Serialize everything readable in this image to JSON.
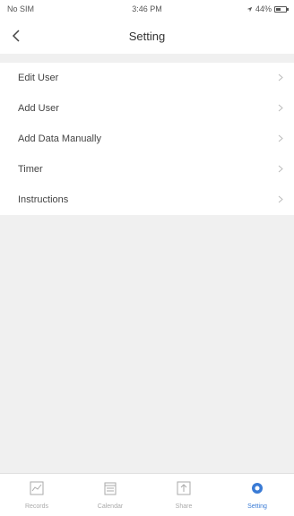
{
  "status_bar": {
    "carrier": "No SIM",
    "time": "3:46 PM",
    "battery": "44%"
  },
  "nav": {
    "title": "Setting",
    "back_icon": "chevron-left-icon"
  },
  "menu": {
    "items": [
      {
        "label": "Edit User"
      },
      {
        "label": "Add User"
      },
      {
        "label": "Add Data Manually"
      },
      {
        "label": "Timer"
      },
      {
        "label": "Instructions"
      }
    ]
  },
  "tab_bar": {
    "tabs": [
      {
        "label": "Records",
        "icon": "records-icon",
        "active": false
      },
      {
        "label": "Calendar",
        "icon": "calendar-icon",
        "active": false
      },
      {
        "label": "Share",
        "icon": "share-icon",
        "active": false
      },
      {
        "label": "Setting",
        "icon": "setting-icon",
        "active": true
      }
    ]
  },
  "colors": {
    "accent": "#3a7bd5",
    "background": "#f0f0f0",
    "inactive": "#aaaaaa"
  }
}
